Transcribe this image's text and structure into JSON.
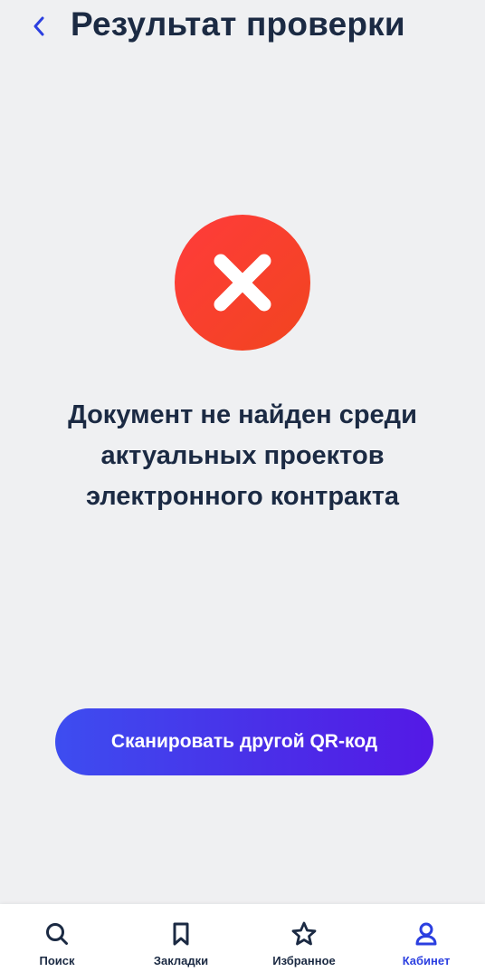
{
  "header": {
    "title": "Результат проверки",
    "back_icon": "chevron-left-icon"
  },
  "result": {
    "status_icon": "close-icon",
    "status_color": "#F4412A",
    "message_lines": [
      "Документ не найден среди",
      "актуальных проектов",
      "электронного контракта"
    ]
  },
  "actions": {
    "scan_again_label": "Сканировать другой QR-код",
    "button_gradient": [
      "#3D4DF0",
      "#5419E6"
    ]
  },
  "tabbar": {
    "active_tab": "Кабинет",
    "active_color": "#2B3FE0",
    "items": [
      {
        "label": "Поиск",
        "icon": "search-icon"
      },
      {
        "label": "Закладки",
        "icon": "bookmark-icon"
      },
      {
        "label": "Избранное",
        "icon": "star-icon"
      },
      {
        "label": "Кабинет",
        "icon": "user-icon"
      }
    ]
  }
}
